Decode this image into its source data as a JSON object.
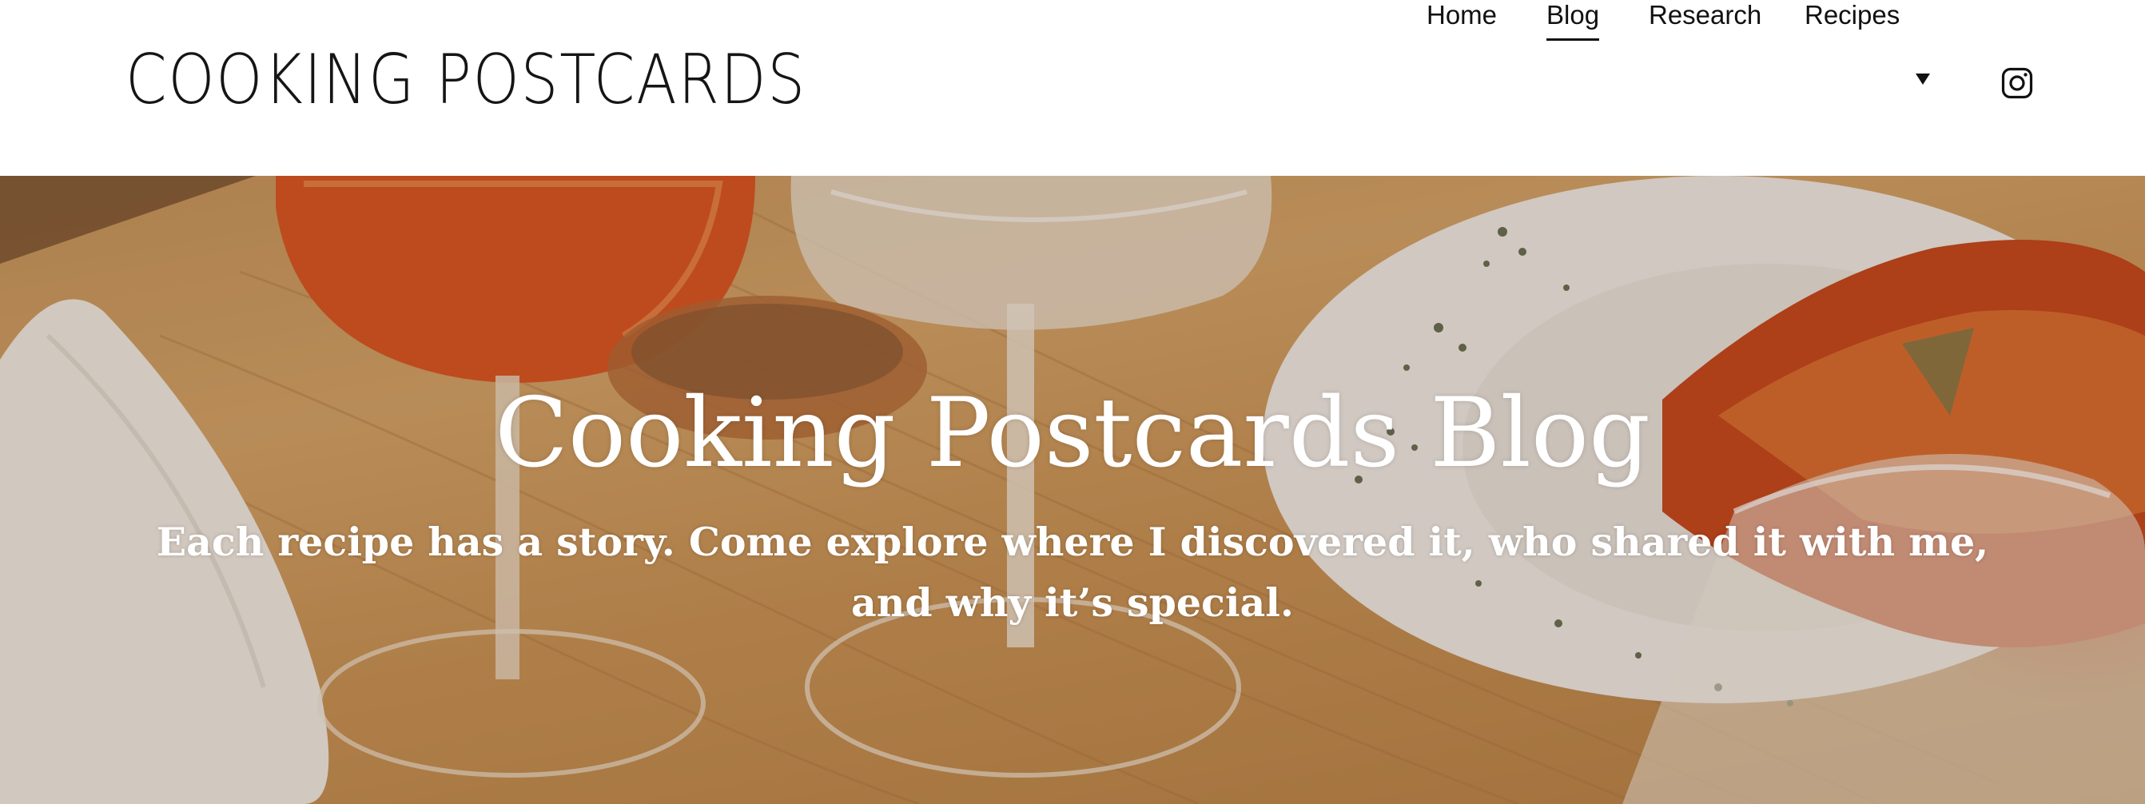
{
  "header": {
    "logo_text": "COOKING POSTCARDS",
    "nav": [
      {
        "label": "Home",
        "active": false
      },
      {
        "label": "Blog",
        "active": true
      },
      {
        "label": "Research",
        "active": false
      },
      {
        "label": "Recipes",
        "active": false,
        "has_dropdown": true
      }
    ],
    "social_icon": "instagram-icon"
  },
  "hero": {
    "title": "Cooking Postcards Blog",
    "subtitle": "Each recipe has a story. Come explore where I discovered it, who shared it with me, and why it’s special."
  },
  "colors": {
    "header_bg": "#ffffff",
    "text_dark": "#111111",
    "hero_text": "#ffffff",
    "wood": "#c99456",
    "drink_orange": "#d9531e"
  }
}
